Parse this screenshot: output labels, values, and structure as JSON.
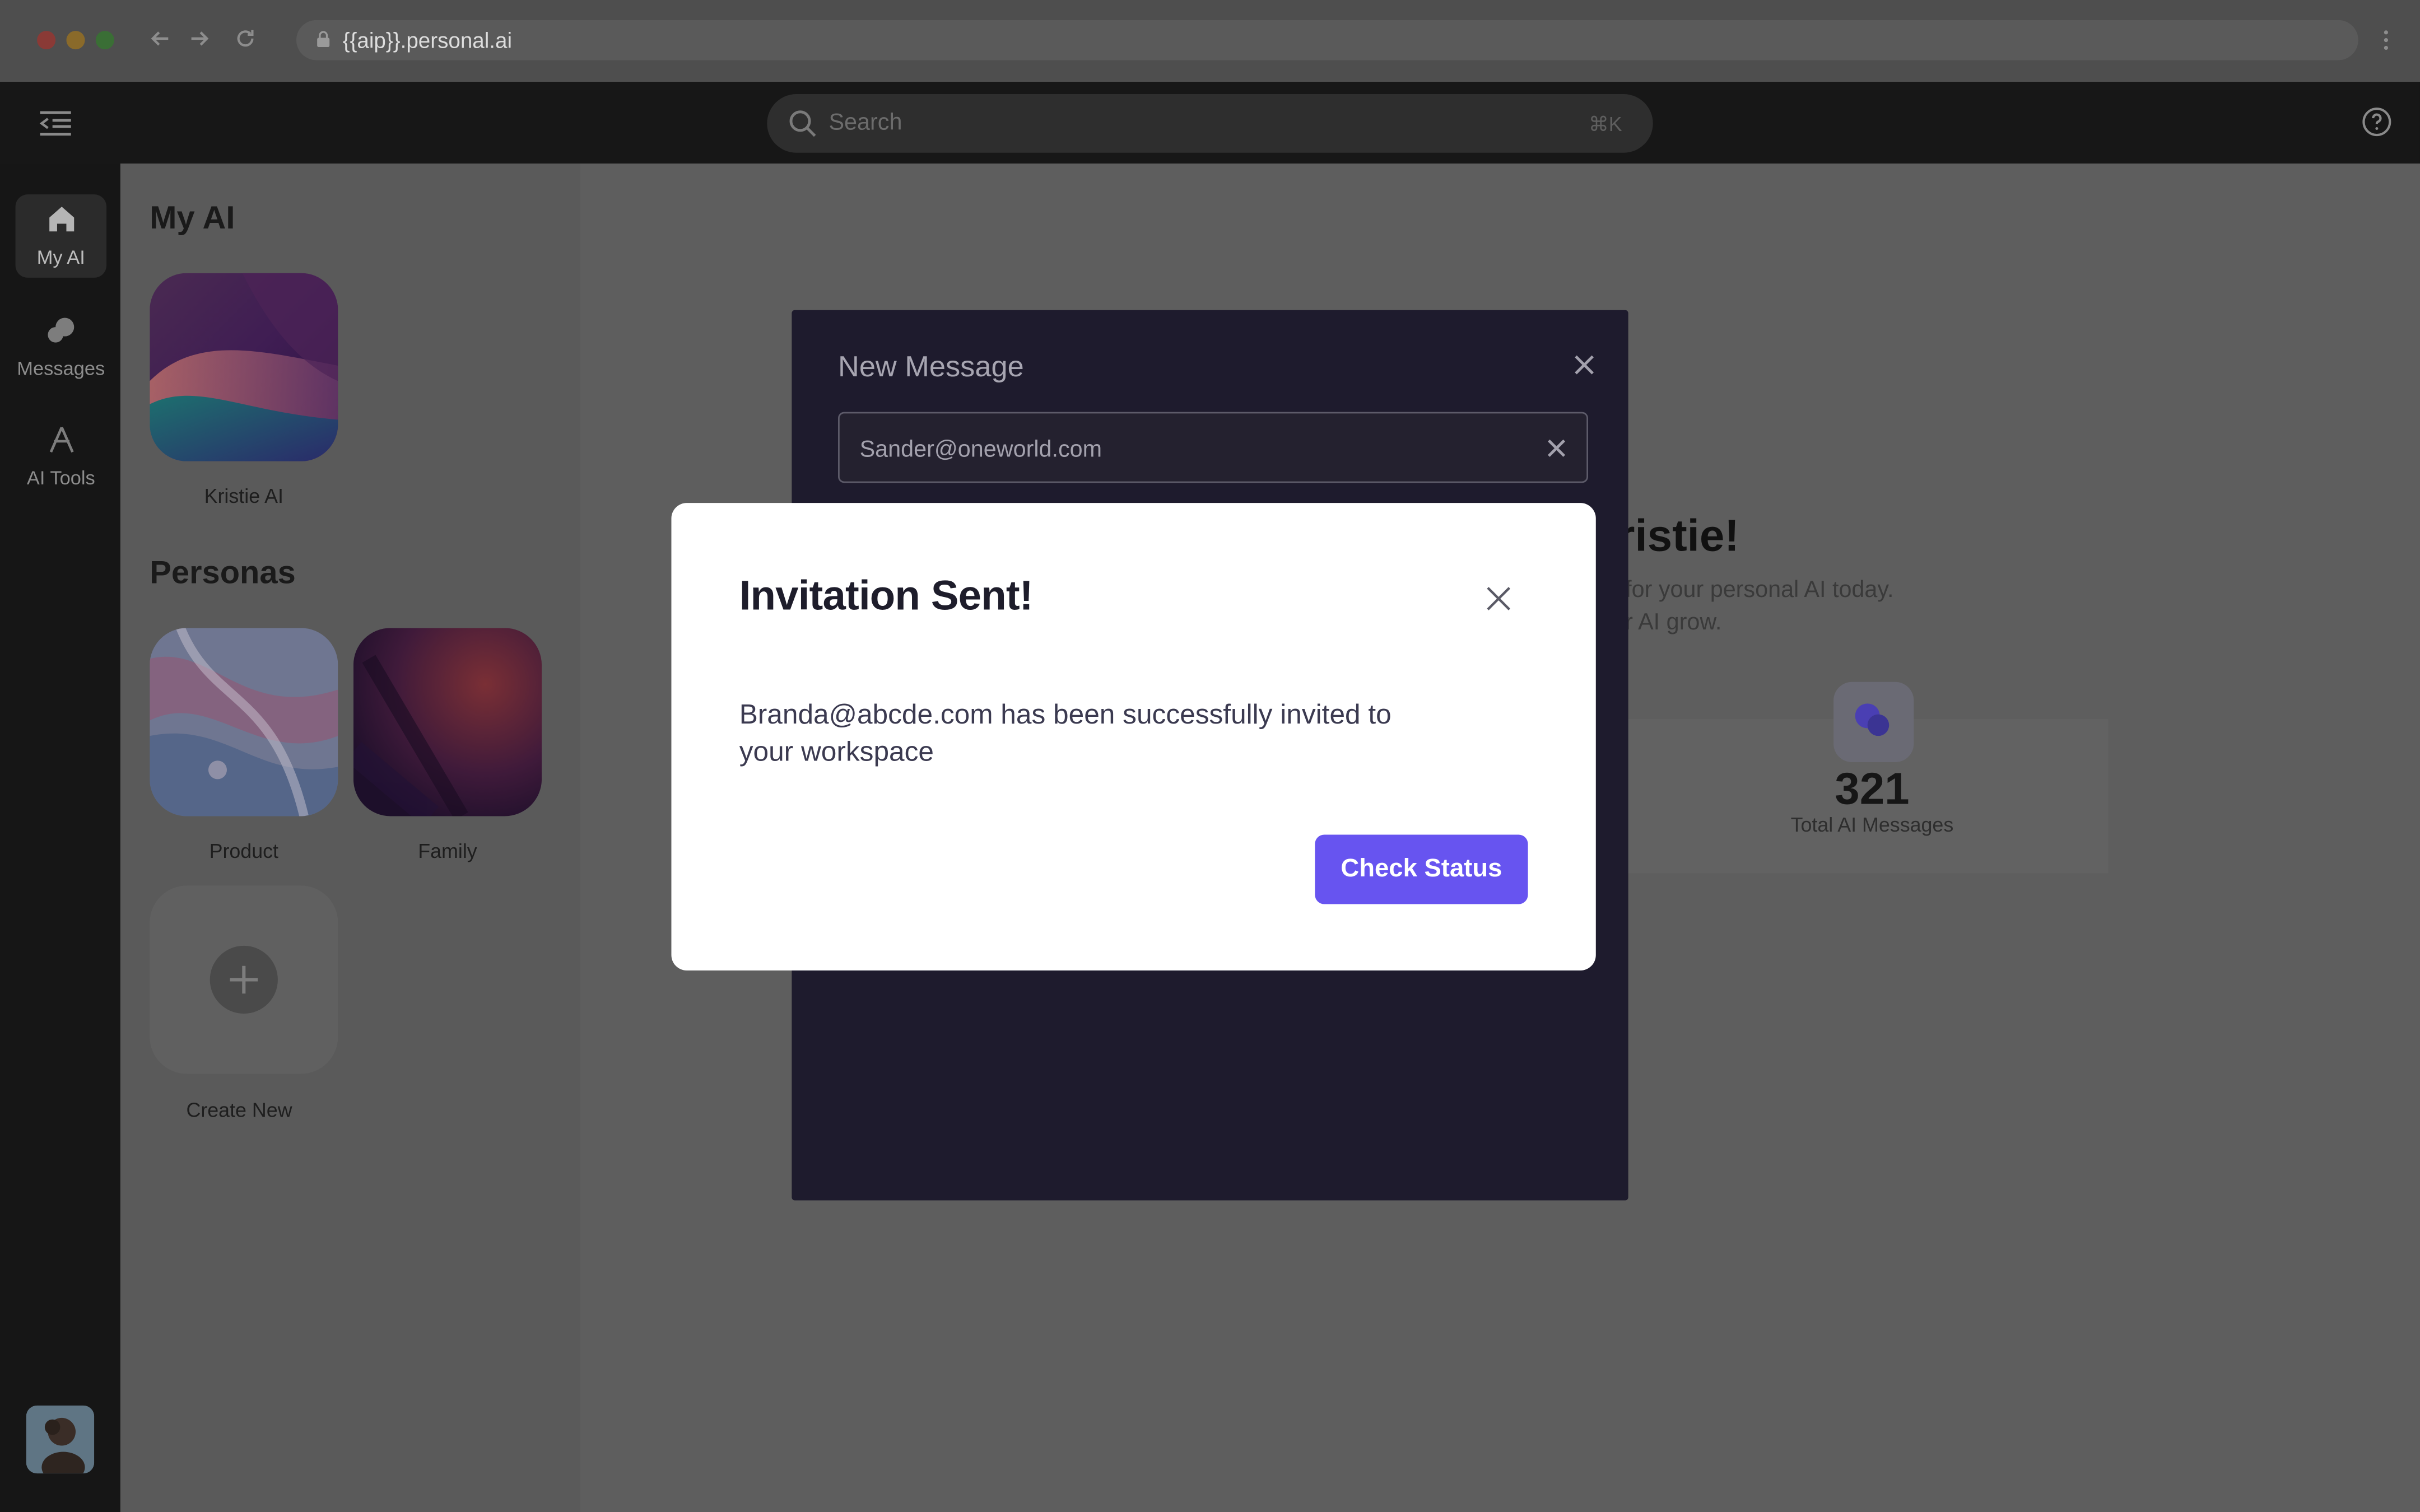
{
  "browser": {
    "url": "{{aip}}.personal.ai"
  },
  "header": {
    "search_placeholder": "Search",
    "search_shortcut": "⌘K"
  },
  "rail": {
    "items": [
      {
        "label": "My AI",
        "icon": "home-icon",
        "active": true
      },
      {
        "label": "Messages",
        "icon": "messages-icon",
        "active": false
      },
      {
        "label": "AI Tools",
        "icon": "ai-tools-icon",
        "active": false
      }
    ]
  },
  "panel": {
    "my_ai_title": "My AI",
    "my_ai_item": "Kristie AI",
    "personas_title": "Personas",
    "personas": [
      "Product",
      "Family"
    ],
    "create_new": "Create New"
  },
  "main": {
    "greeting": "ristie!",
    "subtitle_line1": "for your personal AI today.",
    "subtitle_line2": "r AI grow.",
    "stat_value": "321",
    "stat_label": "Total AI Messages"
  },
  "new_message": {
    "title": "New Message",
    "recipient": "Sander@oneworld.com"
  },
  "dialog": {
    "title": "Invitation Sent!",
    "message": "Branda@abcde.com has been successfully invited to your workspace",
    "button": "Check Status"
  },
  "colors": {
    "accent": "#6754f0",
    "modal_bg": "#1e1b2d"
  }
}
